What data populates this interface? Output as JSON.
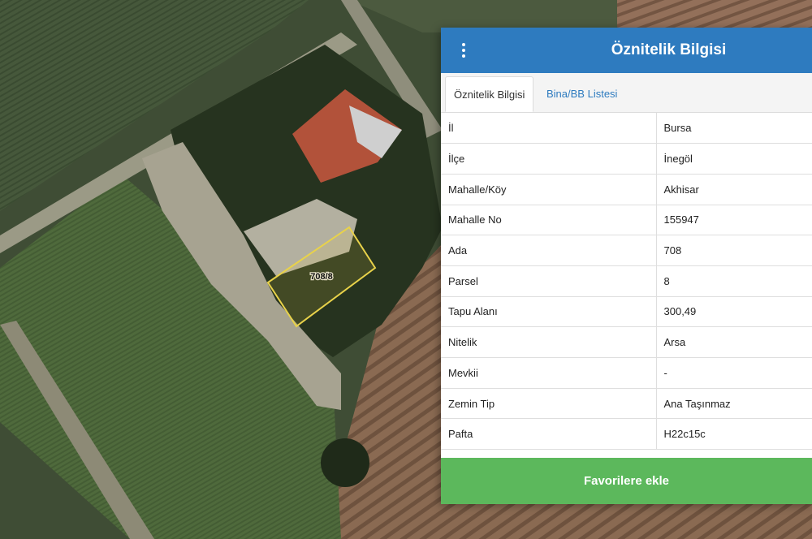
{
  "map": {
    "parcel_label": "708/8"
  },
  "panel": {
    "title": "Öznitelik Bilgisi",
    "tabs": [
      {
        "label": "Öznitelik Bilgisi",
        "active": true
      },
      {
        "label": "Bina/BB Listesi",
        "active": false
      }
    ],
    "attributes": [
      {
        "key": "İl",
        "value": "Bursa"
      },
      {
        "key": "İlçe",
        "value": "İnegöl"
      },
      {
        "key": "Mahalle/Köy",
        "value": "Akhisar"
      },
      {
        "key": "Mahalle No",
        "value": "155947"
      },
      {
        "key": "Ada",
        "value": "708"
      },
      {
        "key": "Parsel",
        "value": "8"
      },
      {
        "key": "Tapu Alanı",
        "value": "300,49"
      },
      {
        "key": "Nitelik",
        "value": "Arsa"
      },
      {
        "key": "Mevkii",
        "value": "-"
      },
      {
        "key": "Zemin Tip",
        "value": "Ana Taşınmaz"
      },
      {
        "key": "Pafta",
        "value": "H22c15c"
      }
    ],
    "favorite_button": "Favorilere ekle"
  },
  "colors": {
    "header": "#2e7bbf",
    "favorite_button": "#5cb85c",
    "parcel_outline": "#e8d24a"
  }
}
